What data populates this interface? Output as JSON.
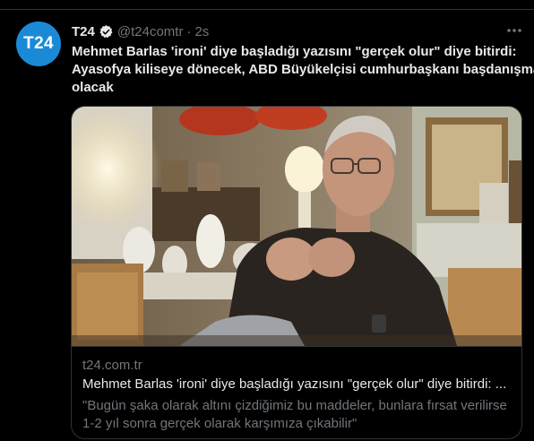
{
  "tweet": {
    "avatar_text": "T24",
    "author_name": "T24",
    "handle": "@t24comtr",
    "separator": "·",
    "time": "2s",
    "text_lines": [
      "Mehmet Barlas 'ironi' diye başladığı yazısını \"gerçek olur\" diye bitirdi:",
      "Ayasofya kiliseye dönecek, ABD Büyükelçisi cumhurbaşkanı başdanışmanı",
      "olacak"
    ],
    "icons": {
      "verified": "verified-badge-icon",
      "more": "more-options-icon"
    }
  },
  "card": {
    "domain": "t24.com.tr",
    "title": "Mehmet Barlas 'ironi' diye başladığı yazısını \"gerçek olur\" diye bitirdi: ...",
    "description_lines": [
      "\"Bugün şaka olarak altını çizdiğimiz bu maddeler, bunlara fırsat verilirse",
      "1-2 yıl sonra gerçek olarak karşımıza çıkabilir\""
    ]
  },
  "colors": {
    "background": "#000000",
    "text_primary": "#e7e9ea",
    "text_secondary": "#71767b",
    "border": "#2f3336",
    "avatar": "#1b8ad6"
  }
}
